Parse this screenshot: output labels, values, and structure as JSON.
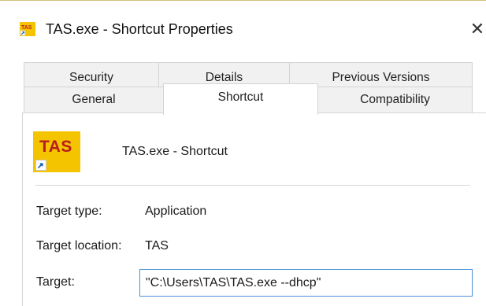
{
  "window": {
    "title": "TAS.exe - Shortcut Properties",
    "close_glyph": "✕"
  },
  "icons": {
    "title_icon": "tas-app-icon",
    "app_icon": "tas-app-icon",
    "app_icon_text": "TAS",
    "title_icon_text": "TAS",
    "shortcut_overlay": "shortcut-arrow-icon"
  },
  "tabs": {
    "row1": [
      {
        "label": "Security"
      },
      {
        "label": "Details"
      },
      {
        "label": "Previous Versions"
      }
    ],
    "row2": [
      {
        "label": "General"
      },
      {
        "label": "Shortcut"
      },
      {
        "label": "Compatibility"
      }
    ],
    "active": "Shortcut"
  },
  "shortcut": {
    "name": "TAS.exe - Shortcut",
    "target_type_label": "Target type:",
    "target_type_value": "Application",
    "target_location_label": "Target location:",
    "target_location_value": "TAS",
    "target_label": "Target:",
    "target_value": "\"C:\\Users\\TAS\\TAS.exe --dhcp\""
  },
  "colors": {
    "icon_background": "#f5c400",
    "icon_text": "#b81c1c",
    "input_focus_border": "#4a90d9"
  }
}
